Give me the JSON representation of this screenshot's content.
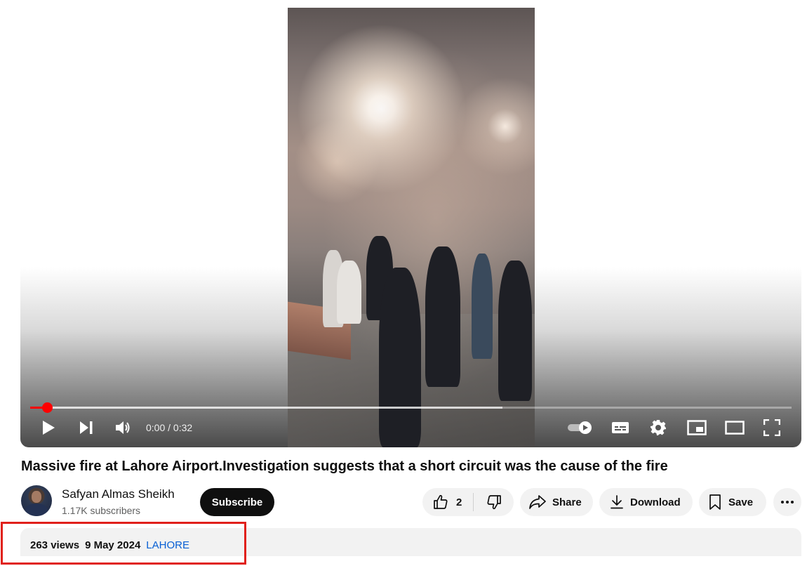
{
  "player": {
    "time_display": "0:00 / 0:32",
    "progress_fraction": 0.0,
    "buffered_fraction": 0.62,
    "controls": [
      "play-icon",
      "next-icon",
      "volume-icon",
      "autoplay-toggle-icon",
      "subtitles-icon",
      "settings-icon",
      "miniplayer-icon",
      "theater-mode-icon",
      "fullscreen-icon"
    ],
    "accent_color": "#ff0000"
  },
  "video": {
    "title": "Massive fire at Lahore Airport.Investigation suggests that a short circuit was the cause of the fire"
  },
  "channel": {
    "name": "Safyan Almas Sheikh",
    "subscribers": "1.17K subscribers",
    "subscribe_label": "Subscribe"
  },
  "actions": {
    "like_count": "2",
    "share_label": "Share",
    "download_label": "Download",
    "save_label": "Save"
  },
  "description": {
    "views": "263 views",
    "date": "9 May 2024",
    "hashtag": "LAHORE"
  },
  "annotation": {
    "highlight_color": "#e0201b"
  }
}
